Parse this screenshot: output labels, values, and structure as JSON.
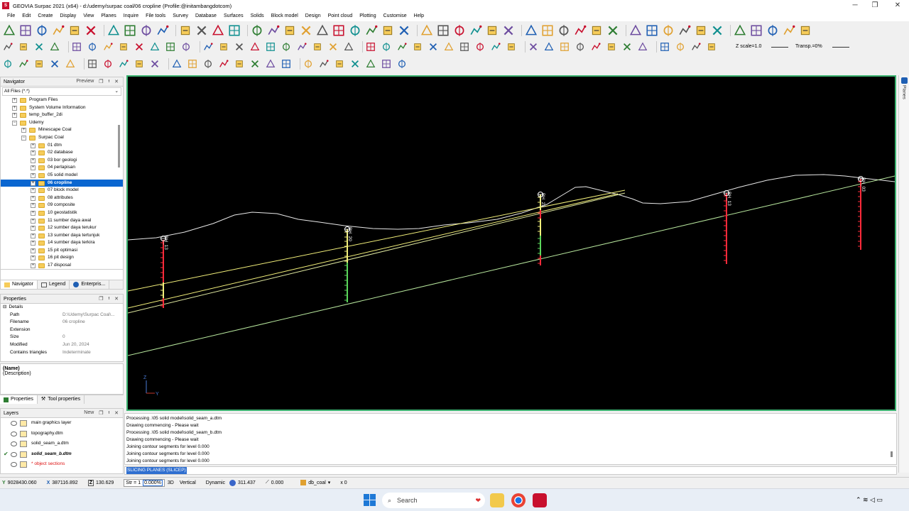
{
  "window": {
    "title": "GEOVIA Surpac 2021 (x64) - d:/udemy/surpac coal/06 cropline (Profile:@initambangdotcom)",
    "logo_text": "S",
    "min_glyph": "─",
    "max_glyph": "❐",
    "close_glyph": "✕"
  },
  "menu": [
    "File",
    "Edit",
    "Create",
    "Display",
    "View",
    "Planes",
    "Inquire",
    "File tools",
    "Survey",
    "Database",
    "Surfaces",
    "Solids",
    "Block model",
    "Design",
    "Point cloud",
    "Plotting",
    "Customise",
    "Help"
  ],
  "toolbar": {
    "zscale_label": "Z scale=1.0",
    "transp_label": "Transp.=0%"
  },
  "navigator": {
    "title": "Navigator",
    "preview": "Preview",
    "filter": "All Files (*.*)",
    "tree": [
      {
        "label": "Program Files",
        "level": 1,
        "exp": "+"
      },
      {
        "label": "System Volume Information",
        "level": 1,
        "exp": "+"
      },
      {
        "label": "temp_buffer_2di",
        "level": 1,
        "exp": "+"
      },
      {
        "label": "Udemy",
        "level": 1,
        "exp": "−"
      },
      {
        "label": "Minescape Coal",
        "level": 2,
        "exp": "+"
      },
      {
        "label": "Surpac Coal",
        "level": 2,
        "exp": "−"
      },
      {
        "label": "01 dtm",
        "level": 3,
        "exp": "+"
      },
      {
        "label": "02 database",
        "level": 3,
        "exp": "+"
      },
      {
        "label": "03 bor geologi",
        "level": 3,
        "exp": "+"
      },
      {
        "label": "04 perlapisan",
        "level": 3,
        "exp": "+"
      },
      {
        "label": "05 solid model",
        "level": 3,
        "exp": "+"
      },
      {
        "label": "06 cropline",
        "level": 3,
        "exp": "+",
        "selected": true
      },
      {
        "label": "07 block model",
        "level": 3,
        "exp": "+"
      },
      {
        "label": "08 attributes",
        "level": 3,
        "exp": "+"
      },
      {
        "label": "09 composite",
        "level": 3,
        "exp": "+"
      },
      {
        "label": "10 geostatistik",
        "level": 3,
        "exp": "+"
      },
      {
        "label": "11 sumber daya awal",
        "level": 3,
        "exp": "+"
      },
      {
        "label": "12 sumber daya terukur",
        "level": 3,
        "exp": "+"
      },
      {
        "label": "13 sumber daya tertunjuk",
        "level": 3,
        "exp": "+"
      },
      {
        "label": "14 sumber daya terkira",
        "level": 3,
        "exp": "+"
      },
      {
        "label": "15 pit optimasi",
        "level": 3,
        "exp": "+"
      },
      {
        "label": "16 pit design",
        "level": 3,
        "exp": "+"
      },
      {
        "label": "17 disposal",
        "level": 3,
        "exp": "+"
      }
    ],
    "tabs": [
      "Navigator",
      "Legend",
      "Enterpris..."
    ]
  },
  "properties": {
    "title": "Properties",
    "section": "Details",
    "rows": [
      {
        "k": "Path",
        "v": "D:\\Udemy\\Surpac Coal\\..."
      },
      {
        "k": "Filename",
        "v": "06 cropline"
      },
      {
        "k": "Extension",
        "v": ""
      },
      {
        "k": "Size",
        "v": "0"
      },
      {
        "k": "Modified",
        "v": "Jun 20, 2024"
      },
      {
        "k": "Contains triangles",
        "v": "Indeterminate"
      }
    ],
    "tabs": [
      "Properties",
      "Tool properties"
    ]
  },
  "description": {
    "name": "(Name)",
    "desc": "(Description)"
  },
  "layers": {
    "title": "Layers",
    "new_label": "New",
    "items": [
      {
        "name": "main graphics layer",
        "active": false,
        "style": "normal"
      },
      {
        "name": "topography.dtm",
        "active": false,
        "style": "normal"
      },
      {
        "name": "solid_seam_a.dtm",
        "active": false,
        "style": "normal"
      },
      {
        "name": "solid_seam_b.dtm",
        "active": true,
        "style": "bold"
      },
      {
        "name": "* object sections",
        "active": false,
        "style": "red"
      }
    ]
  },
  "viewport": {
    "bg": "#000000",
    "frame": "#3cb371",
    "axis_z": "Z",
    "axis_y": "Y",
    "holes": [
      {
        "name": "BH_13"
      },
      {
        "name": "BH_20"
      },
      {
        "name": "BH_23"
      },
      {
        "name": "BH_13"
      },
      {
        "name": "BH_03"
      }
    ]
  },
  "right_strip": {
    "label": "Planes"
  },
  "output": {
    "lines": [
      "Processing  .\\05 solid model\\solid_seam_a.dtm",
      "Drawing commencing - Please wait",
      "Processing  .\\05 solid model\\solid_seam_b.dtm",
      "Drawing commencing - Please wait",
      "Joining contour segments for level 0.000",
      "Joining contour segments for level 0.000",
      "Joining contour segments for level 0.000"
    ]
  },
  "command": {
    "value": "SLICING PLANES (SLICEP)"
  },
  "status": {
    "y_label": "Y",
    "y": "9028430.060",
    "x_label": "X",
    "x": "387116.892",
    "z_label": "Z",
    "z": "130.629",
    "str": "Str = 1",
    "pct": "0.000%",
    "mode3d": "3D",
    "vertical": "Vertical",
    "dynamic": "Dynamic",
    "bearing": "311.437",
    "dip": "0.000",
    "db": "db_coal",
    "x0": "x 0"
  },
  "taskbar": {
    "search_placeholder": "Search"
  }
}
